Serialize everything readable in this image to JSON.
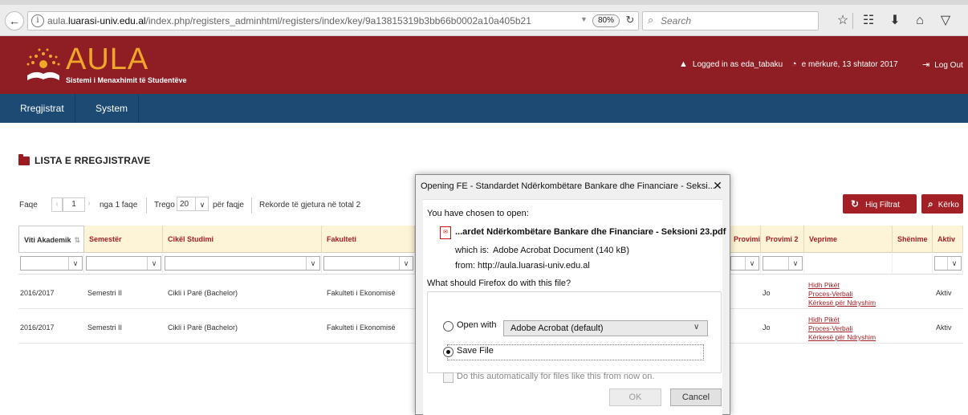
{
  "browser": {
    "url_prefix": "aula.",
    "url_domain": "luarasi-univ.edu.al",
    "url_path": "/index.php/registers_adminhtml/registers/index/key/9a13815319b3bb66b0002a10a405b21",
    "zoom": "80%",
    "search_placeholder": "Search"
  },
  "header": {
    "logo_title": "AULA",
    "logo_subtitle": "Sistemi i Menaxhimit të Studentëve",
    "logged_in": "Logged in as eda_tabaku",
    "date": "e mërkurë, 13 shtator 2017",
    "logout": "Log Out"
  },
  "nav": {
    "items": [
      {
        "label": "Rregjistrat"
      },
      {
        "label": "System"
      }
    ]
  },
  "page": {
    "title": "LISTA E RREGJISTRAVE",
    "pager": {
      "page_label": "Faqe",
      "page_value": "1",
      "of_pages": "nga 1 faqe",
      "show_label": "Trego",
      "per_page_value": "20",
      "per_page_suffix": "për faqje",
      "records": "Rekorde të gjetura në total 2"
    },
    "buttons": {
      "clear_filters": "Hiq Filtrat",
      "search": "Kërko"
    }
  },
  "table": {
    "headers": {
      "year": "Viti Akademik",
      "semester": "Semestër",
      "cycle": "Cikël Studimi",
      "faculty": "Fakulteti",
      "exam1": "Provimi 1",
      "exam2": "Provimi 2",
      "actions": "Veprime",
      "notes": "Shënime",
      "active": "Aktiv"
    },
    "rows": [
      {
        "year": "2016/2017",
        "semester": "Semestri II",
        "cycle": "Cikli i Parë (Bachelor)",
        "faculty": "Fakulteti i Ekonomisë",
        "exam2": "Jo",
        "actions": [
          "Hidh Pikët",
          "Proces-Verbali",
          "Kërkesë për Ndryshim"
        ],
        "active": "Aktiv"
      },
      {
        "year": "2016/2017",
        "semester": "Semestri II",
        "cycle": "Cikli i Parë (Bachelor)",
        "faculty": "Fakulteti i Ekonomisë",
        "exam2": "Jo",
        "actions": [
          "Hidh Pikët",
          "Proces-Verbali",
          "Kërkesë për Ndryshim"
        ],
        "active": "Aktiv"
      }
    ]
  },
  "dialog": {
    "title": "Opening FE - Standardet Ndërkombëtare Bankare dhe Financiare - Seksi...",
    "intro": "You have chosen to open:",
    "filename": "...ardet Ndërkombëtare Bankare dhe Financiare - Seksioni 23.pdf",
    "which_is_label": "which is:",
    "which_is_value": "Adobe Acrobat Document (140 kB)",
    "from_label": "from:",
    "from_value": "http://aula.luarasi-univ.edu.al",
    "question": "What should Firefox do with this file?",
    "open_with": "Open with",
    "open_with_app": "Adobe Acrobat  (default)",
    "save_file": "Save File",
    "auto_label": "Do this automatically for files like this from now on.",
    "ok": "OK",
    "cancel": "Cancel"
  }
}
